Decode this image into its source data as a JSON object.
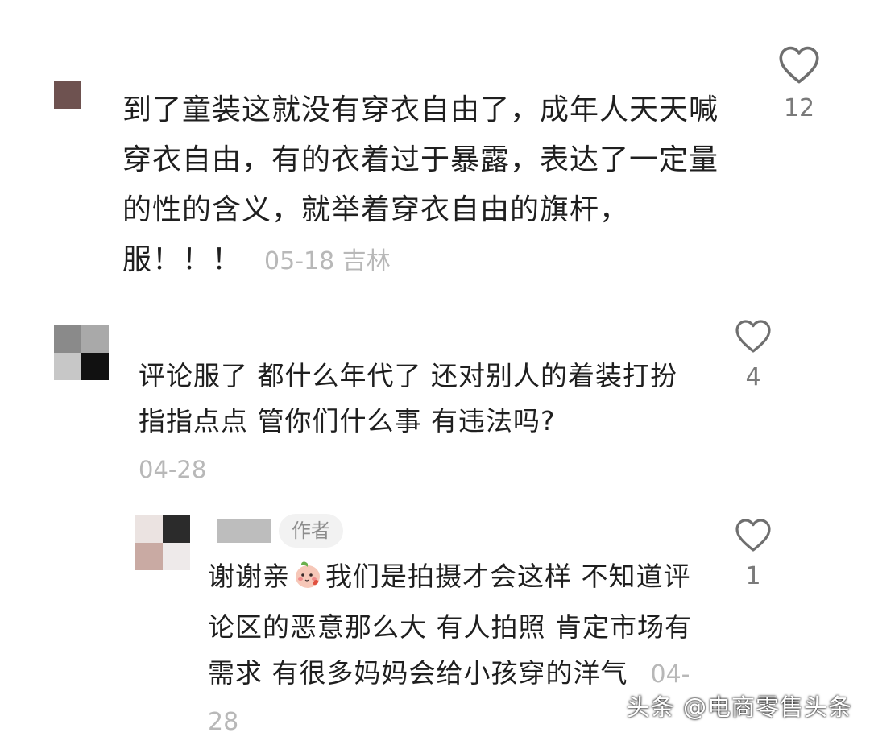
{
  "comments": [
    {
      "text": "到了童装这就没有穿衣自由了，成年人天天喊穿衣自由，有的衣着过于暴露，表达了一定量的性的含义，就举着穿衣自由的旗杆，服！！！",
      "meta": "05-18 吉林",
      "likes": "12",
      "avatar_color": "#6e5250"
    },
    {
      "text": "评论服了 都什么年代了 还对别人的着装打扮指指点点 管你们什么事 有违法吗?",
      "meta": "04-28",
      "likes": "4",
      "avatar_colors": [
        "#8a8a8a",
        "#a9a9a9",
        "#c7c7c7",
        "#111111"
      ]
    },
    {
      "author_badge": "作者",
      "text_before_emoji": "谢谢亲",
      "emoji": "peach-face-emoji",
      "text_after_emoji": "我们是拍摄才会这样 不知道评论区的恶意那么大   有人拍照 肯定市场有需求 有很多妈妈会给小孩穿的洋气",
      "meta": "04-28",
      "likes": "1",
      "avatar_colors": [
        "#ebe3e1",
        "#2b2b2b",
        "#c9aaa3",
        "#eeeaea"
      ]
    }
  ],
  "watermark": "头条 @电商零售头条",
  "colors": {
    "text": "#1f1f1f",
    "meta": "#b8b8b8",
    "icon": "#6f6f6f",
    "badge_bg": "#f2f2f2"
  }
}
